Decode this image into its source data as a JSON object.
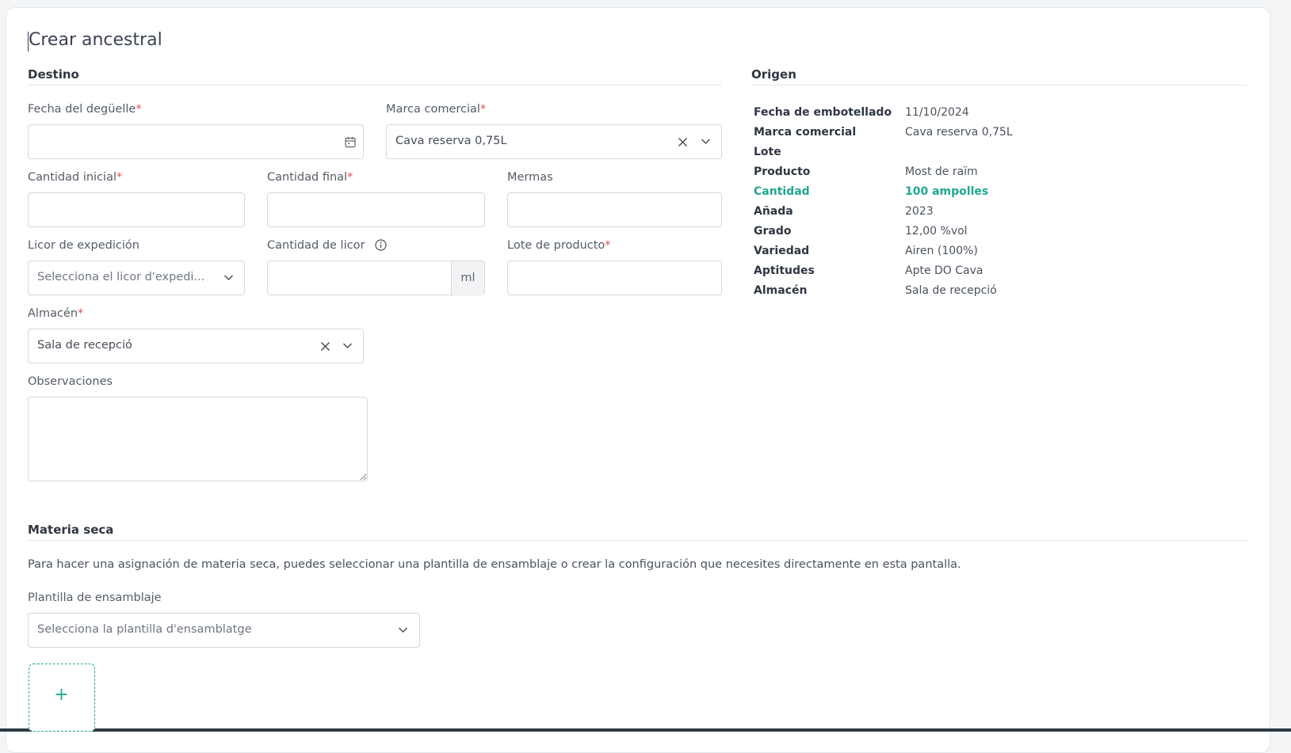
{
  "page": {
    "title": "Crear ancestral"
  },
  "destino": {
    "heading": "Destino",
    "fecha_deguelle": {
      "label": "Fecha del degüelle",
      "required_mark": "*",
      "value": ""
    },
    "marca_comercial": {
      "label": "Marca comercial",
      "required_mark": "*",
      "value": "Cava reserva 0,75L"
    },
    "cantidad_inicial": {
      "label": "Cantidad inicial",
      "required_mark": "*",
      "value": ""
    },
    "cantidad_final": {
      "label": "Cantidad final",
      "required_mark": "*",
      "value": ""
    },
    "mermas": {
      "label": "Mermas",
      "value": ""
    },
    "licor_expedicion": {
      "label": "Licor de expedición",
      "placeholder": "Selecciona el licor d'expedi..."
    },
    "cantidad_licor": {
      "label": "Cantidad de licor",
      "unit": "ml",
      "value": ""
    },
    "lote_producto": {
      "label": "Lote de producto",
      "required_mark": "*",
      "value": ""
    },
    "almacen": {
      "label": "Almacén",
      "required_mark": "*",
      "value": "Sala de recepció"
    },
    "observaciones": {
      "label": "Observaciones",
      "value": ""
    }
  },
  "origen": {
    "heading": "Origen",
    "rows": [
      {
        "key": "Fecha de embotellado",
        "value": "11/10/2024"
      },
      {
        "key": "Marca comercial",
        "value": "Cava reserva 0,75L"
      },
      {
        "key": "Lote",
        "value": ""
      },
      {
        "key": "Producto",
        "value": "Most de raïm"
      },
      {
        "key": "Cantidad",
        "value": "100 ampolles",
        "highlight": true
      },
      {
        "key": "Añada",
        "value": "2023"
      },
      {
        "key": "Grado",
        "value": "12,00 %vol"
      },
      {
        "key": "Variedad",
        "value": "Airen (100%)"
      },
      {
        "key": "Aptitudes",
        "value": "Apte DO Cava"
      },
      {
        "key": "Almacén",
        "value": "Sala de recepció"
      }
    ]
  },
  "materia_seca": {
    "heading": "Materia seca",
    "help": "Para hacer una asignación de materia seca, puedes seleccionar una plantilla de ensamblaje o crear la configuración que necesites directamente en esta pantalla.",
    "plantilla": {
      "label": "Plantilla de ensamblaje",
      "placeholder": "Selecciona la plantilla d'ensamblatge"
    },
    "add_symbol": "+"
  },
  "colors": {
    "accent": "#20a88f",
    "required": "#e05252",
    "border": "#d4d9de"
  },
  "icons": [
    "calendar-icon",
    "clear-icon",
    "chevron-down-icon",
    "info-icon",
    "plus-icon"
  ]
}
